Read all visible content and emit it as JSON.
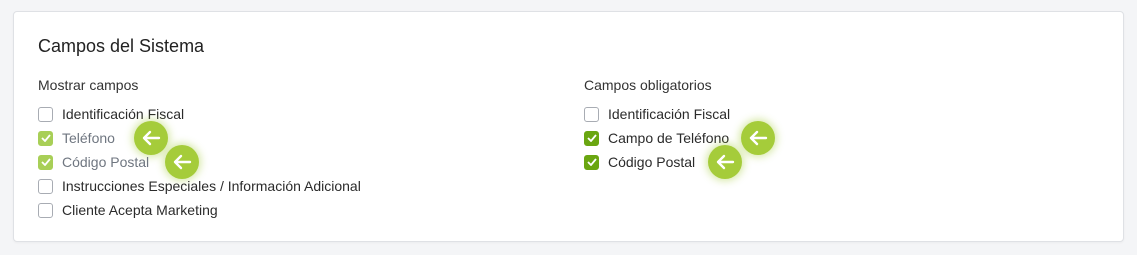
{
  "section": {
    "title": "Campos del Sistema"
  },
  "show_fields": {
    "label": "Mostrar campos",
    "items": [
      {
        "label": "Identificación Fiscal",
        "checked": false
      },
      {
        "label": "Teléfono",
        "checked": true
      },
      {
        "label": "Código Postal",
        "checked": true
      },
      {
        "label": "Instrucciones Especiales / Información Adicional",
        "checked": false
      },
      {
        "label": "Cliente Acepta Marketing",
        "checked": false
      }
    ]
  },
  "required_fields": {
    "label": "Campos obligatorios",
    "items": [
      {
        "label": "Identificación Fiscal",
        "checked": false
      },
      {
        "label": "Campo de Teléfono",
        "checked": true
      },
      {
        "label": "Código Postal",
        "checked": true
      }
    ]
  },
  "colors": {
    "accent_soft": "#a8cf57",
    "accent_strong": "#6aa611",
    "pointer": "#a5cc3a"
  },
  "icons": {
    "checkmark": "check-icon",
    "pointer": "arrow-left-icon"
  }
}
